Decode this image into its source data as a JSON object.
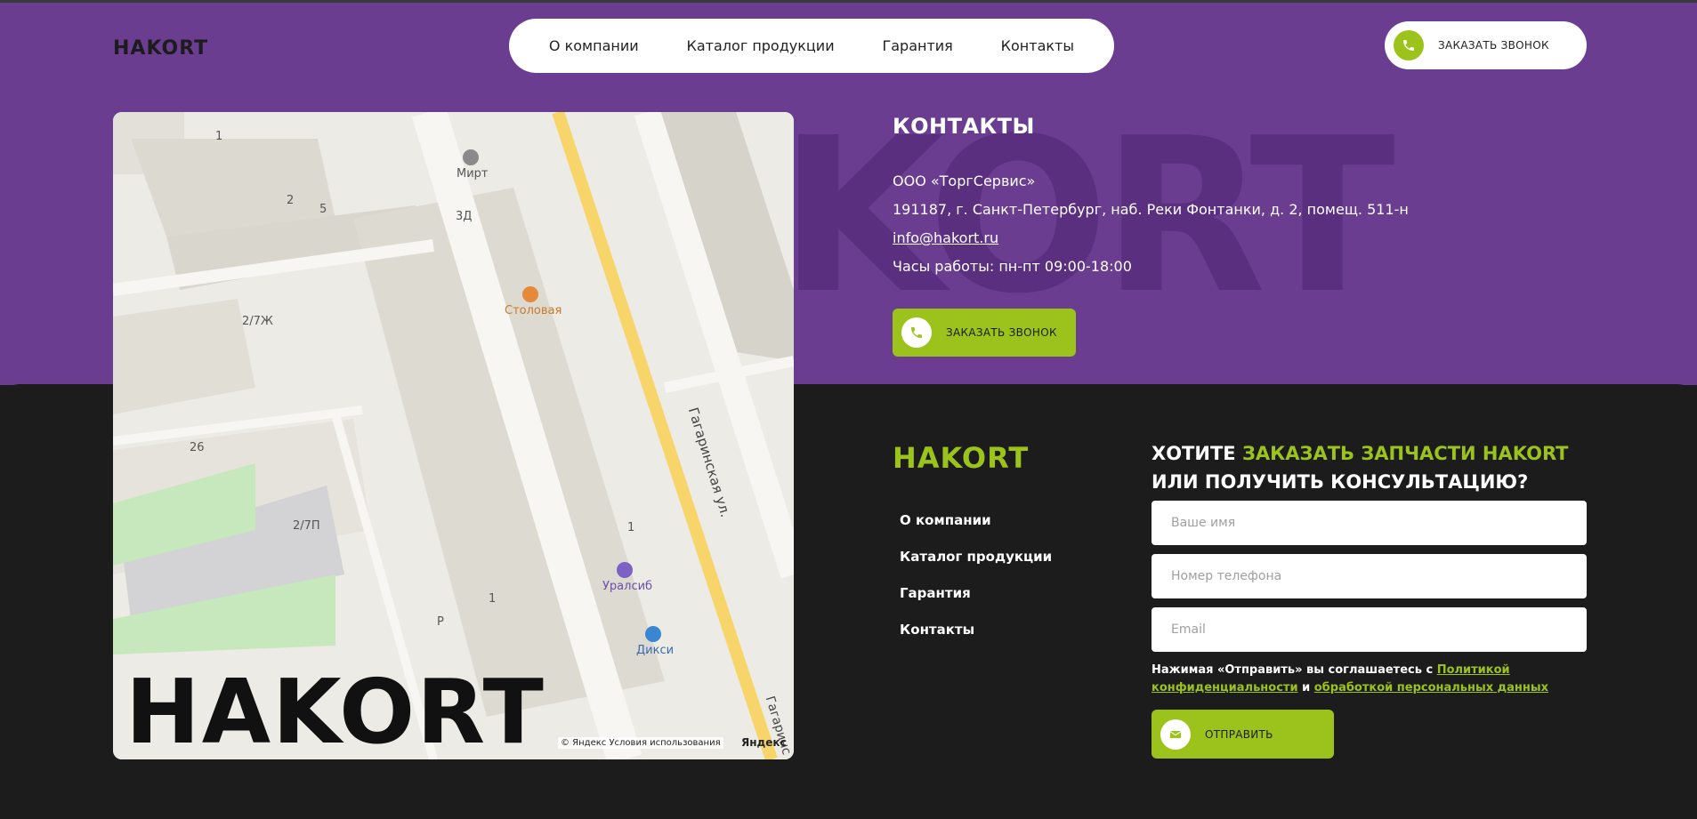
{
  "header": {
    "logo": "HAKORT",
    "nav": [
      "О компании",
      "Каталог продукции",
      "Гарантия",
      "Контакты"
    ],
    "call_button": "ЗАКАЗАТЬ ЗВОНОК"
  },
  "hero": {
    "watermark": "KORT"
  },
  "map": {
    "labels": {
      "mirt": "Мирт",
      "stolovaya": "Столовая",
      "uralsib": "Уралсиб",
      "diksi": "Дикси",
      "b1a": "1",
      "b2": "2",
      "b5": "5",
      "b3d": "3Д",
      "b27zh": "2/7Ж",
      "b26": "26",
      "b27p": "2/7П",
      "b1b": "1",
      "b1c": "1",
      "p": "P",
      "street": "Гагаринская ул.",
      "street2": "Гагаринс"
    },
    "overlay_logo": "HAKORT",
    "credit": "© Яндекс Условия использования",
    "credit_brand": "Яндекс"
  },
  "contacts": {
    "title": "КОНТАКТЫ",
    "company": "ООО «ТоргСервис»",
    "address": "191187, г. Санкт-Петербург, наб. Реки Фонтанки, д. 2, помещ. 511-н",
    "email": "info@hakort.ru",
    "hours": "Часы работы: пн-пт 09:00-18:00",
    "call_button": "ЗАКАЗАТЬ ЗВОНОК"
  },
  "footer": {
    "logo": "HAKORT",
    "links": [
      "О компании",
      "Каталог продукции",
      "Гарантия",
      "Контакты"
    ]
  },
  "form": {
    "title_pre": "ХОТИТЕ ",
    "title_accent": "ЗАКАЗАТЬ ЗАПЧАСТИ HAKORT",
    "title_post": " ИЛИ ПОЛУЧИТЬ КОНСУЛЬТАЦИЮ?",
    "name_placeholder": "Ваше имя",
    "phone_placeholder": "Номер телефона",
    "email_placeholder": "Email",
    "consent_pre": "Нажимая «Отправить» вы соглашаетесь с ",
    "consent_link1": "Политикой конфиденциальности",
    "consent_mid": " и ",
    "consent_link2": "обработкой персональных данных",
    "submit": "ОТПРАВИТЬ"
  },
  "colors": {
    "purple": "#6a3d91",
    "accent_green": "#9bc31b",
    "dark": "#1c1c1c"
  }
}
